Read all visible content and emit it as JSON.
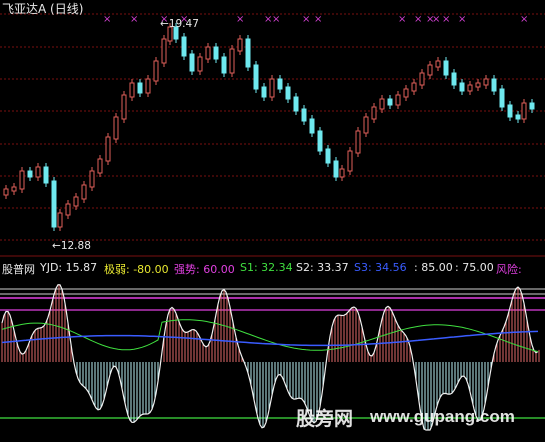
{
  "title": "飞亚达A (日线)",
  "price_panel": {
    "high_label": "19.47",
    "low_label": "12.88",
    "up_color": "#e0605a",
    "down_color": "#6fe9ef",
    "marker_color": "#d040d0",
    "marker_symbol": "×",
    "marker_icon": "cross-mark-icon"
  },
  "indicator": {
    "site_label": "股普网",
    "yjd": "YJD: 15.87",
    "jiruo": "极弱: -80.00",
    "qiangshi": "强势: 60.00",
    "s1": "S1: 32.34",
    "s2": "S2: 33.37",
    "s3": "S3: 34.56",
    "v85": ": 85.00",
    "v75": ": 75.00",
    "fengxian": "风险:",
    "colors": {
      "yjd": "#e8e8e8",
      "jiruo": "#e8e830",
      "qiangshi": "#e040e0",
      "s1": "#40e040",
      "s2": "#e8e8e8",
      "s3": "#3a5cff",
      "v85": "#e8e8e8",
      "v75": "#e8e8e8",
      "fengxian": "#e040e0"
    }
  },
  "watermark": {
    "cn": "股旁网",
    "url": "www.gupang.com"
  }
}
